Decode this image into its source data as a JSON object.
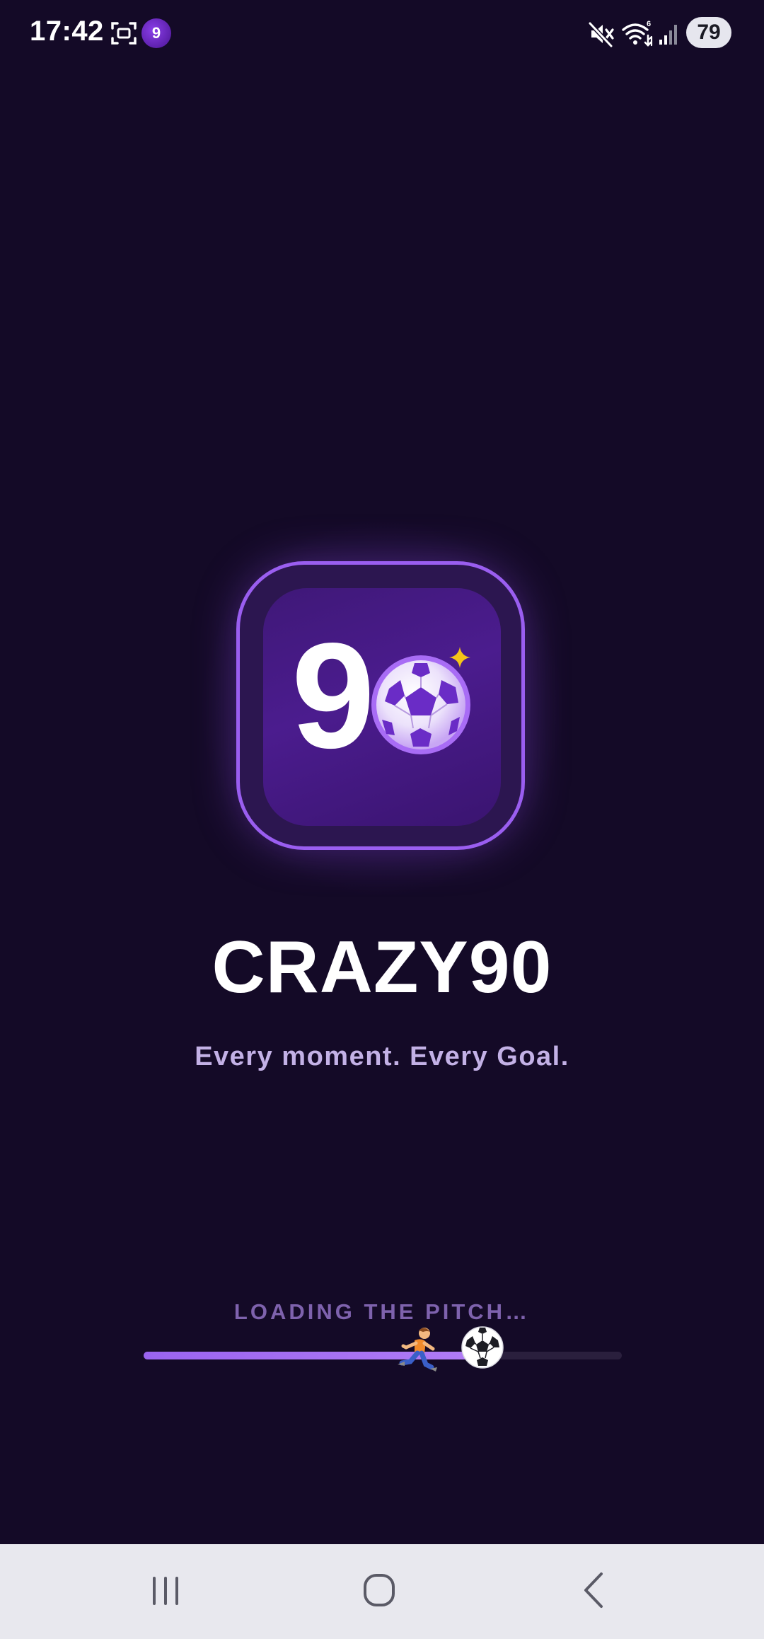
{
  "status_bar": {
    "time": "17:42",
    "app_badge": "9",
    "battery": "79",
    "icons": [
      "screenshot-icon",
      "app-badge-icon",
      "mute-icon",
      "wifi-icon",
      "signal-icon",
      "battery-badge"
    ]
  },
  "splash": {
    "logo": {
      "number": "9",
      "ball_icon": "soccer-ball-icon",
      "sparkle_icon": "sparkle-icon"
    },
    "title": "CRAZY90",
    "tagline": "Every moment. Every Goal."
  },
  "loading": {
    "label": "LOADING THE PITCH…",
    "progress": 0.7,
    "runner_icon": "runner-icon",
    "ball_icon": "soccer-ball-icon"
  },
  "nav_bar": {
    "buttons": [
      "recents-icon",
      "home-icon",
      "back-icon"
    ]
  },
  "colors": {
    "background": "#140a27",
    "accent": "#9a5ef0",
    "tagline": "#c3b1e6",
    "loading_label": "#7e62ad",
    "sparkle": "#f5c518"
  }
}
